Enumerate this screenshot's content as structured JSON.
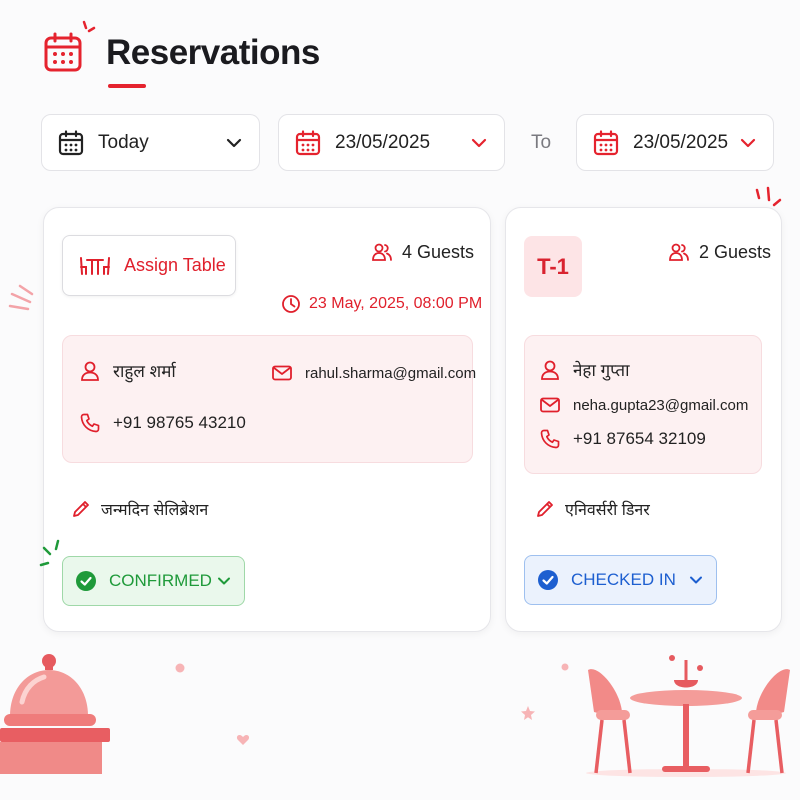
{
  "header": {
    "title": "Reservations",
    "icon": "calendar-icon"
  },
  "filters": {
    "range_label": "Today",
    "from_date": "23/05/2025",
    "to_label": "To",
    "to_date": "23/05/2025"
  },
  "colors": {
    "accent": "#e5232e",
    "confirmed": "#1f9a3a",
    "checked_in": "#1d5fd0"
  },
  "reservations": [
    {
      "action_label": "Assign Table",
      "guests": "4 Guests",
      "datetime": "23 May, 2025, 08:00 PM",
      "name": "राहुल शर्मा",
      "email": "rahul.sharma@gmail.com",
      "phone": "+91 98765 43210",
      "note": "जन्मदिन सेलिब्रेशन",
      "status": "CONFIRMED"
    },
    {
      "table": "T-1",
      "guests": "2 Guests",
      "name": "नेहा गुप्ता",
      "email": "neha.gupta23@gmail.com",
      "phone": "+91 87654 32109",
      "note": "एनिवर्सरी डिनर",
      "status": "CHECKED IN"
    }
  ]
}
